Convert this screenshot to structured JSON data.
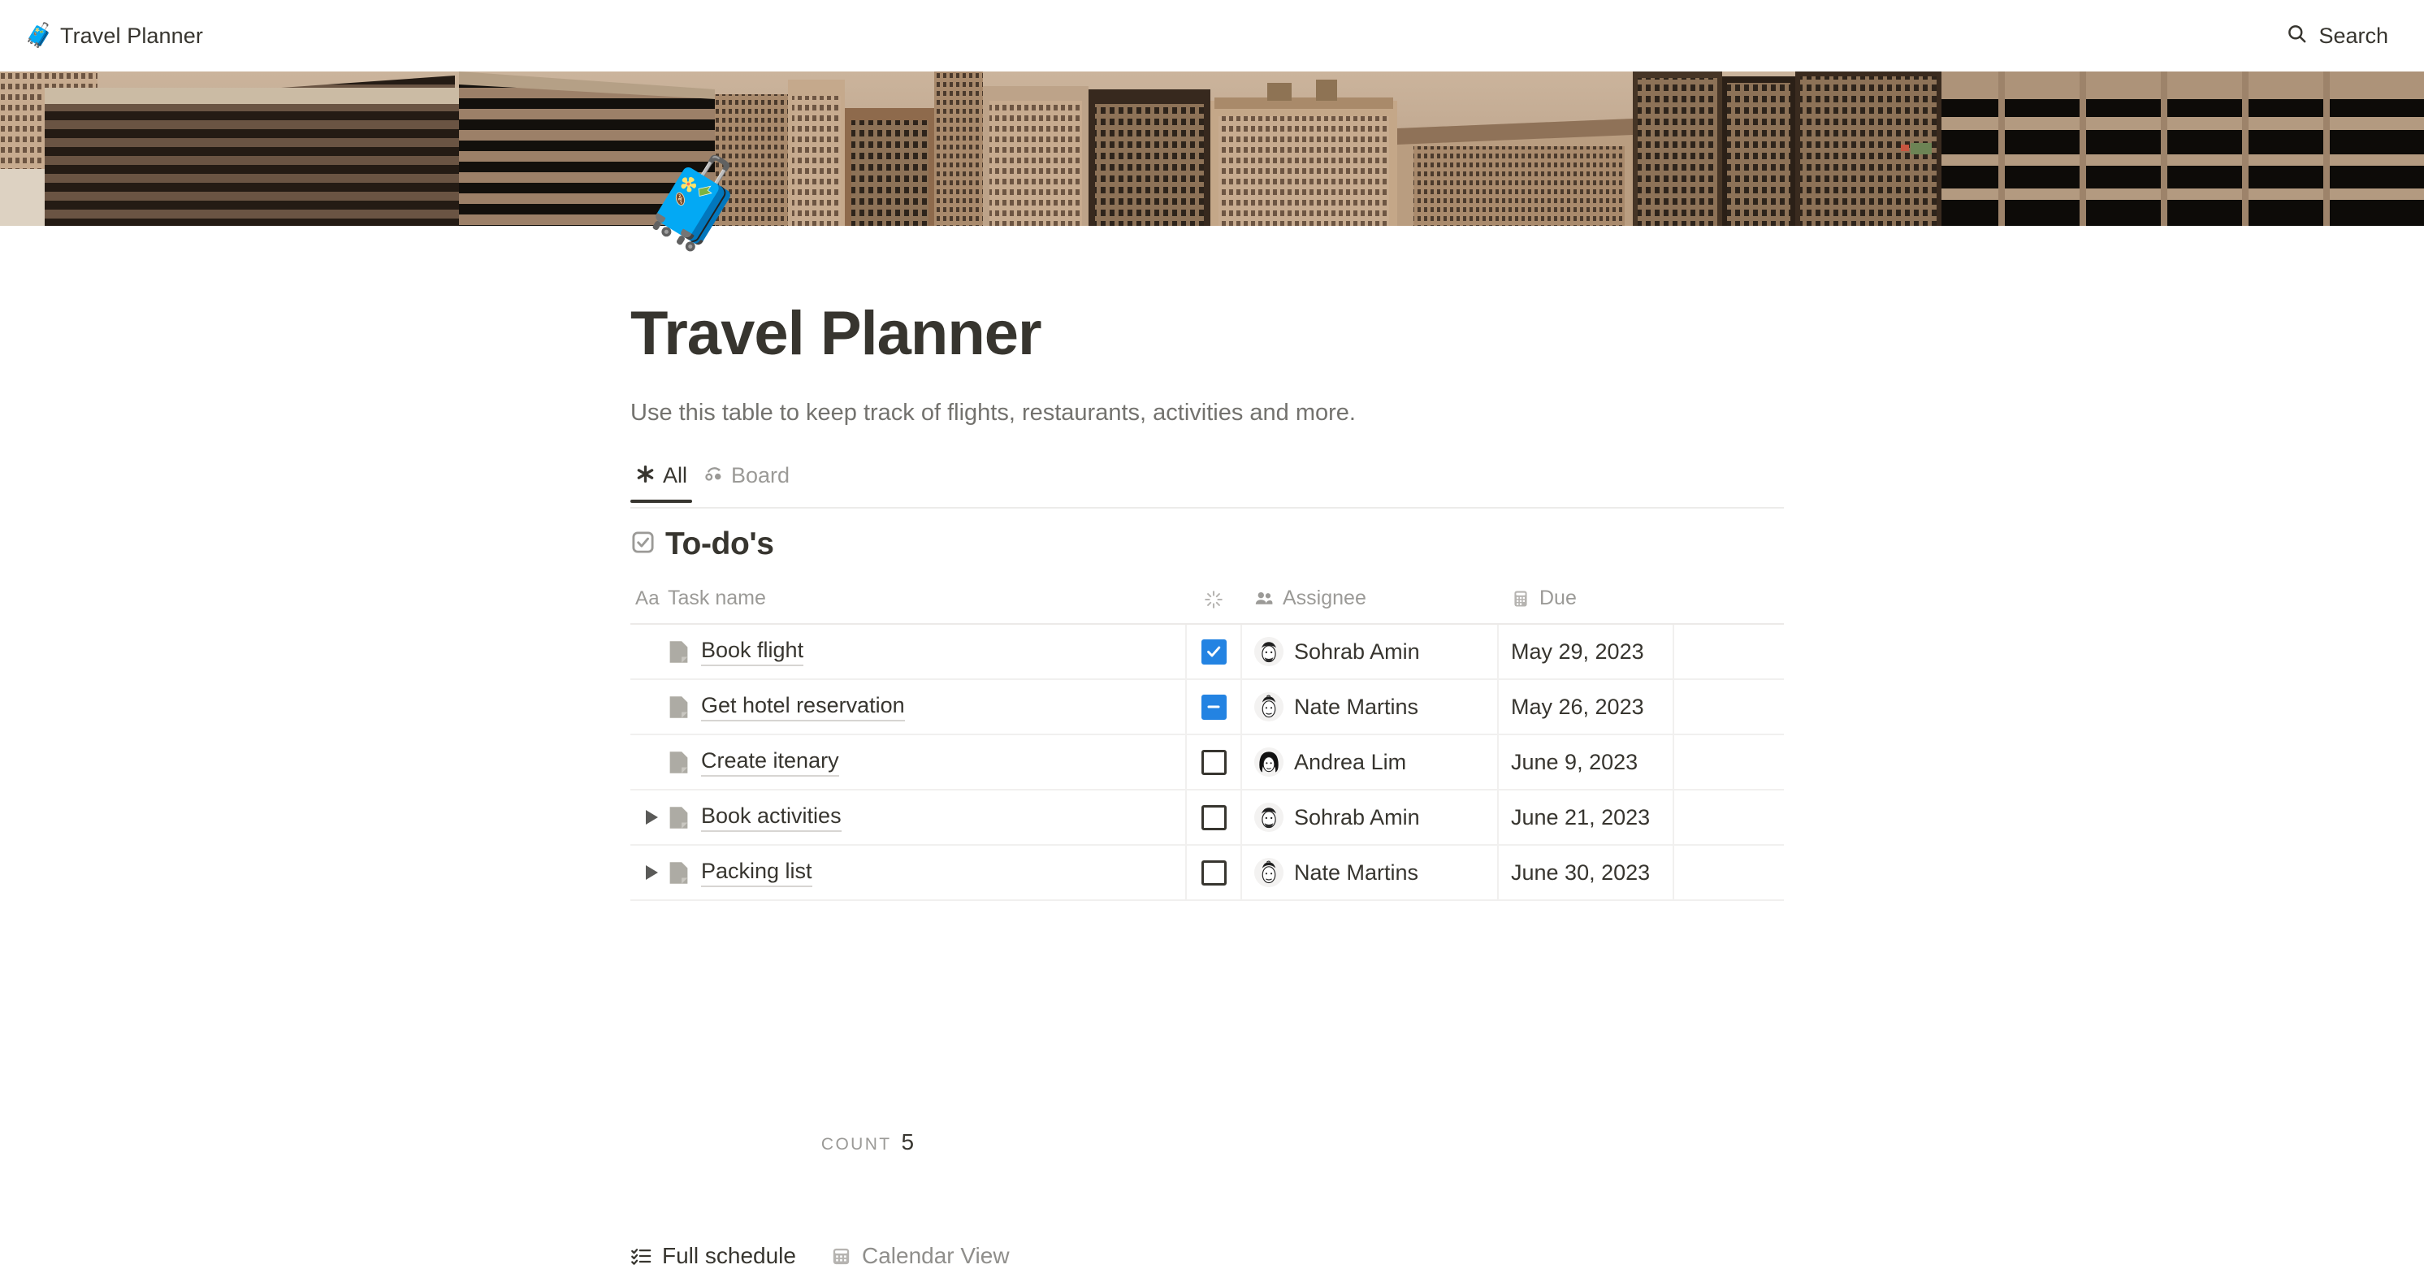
{
  "topbar": {
    "breadcrumb_emoji": "🧳",
    "breadcrumb_icon_name": "suitcase-icon",
    "breadcrumb_title": "Travel Planner",
    "search_icon_name": "search-icon",
    "search_label": "Search"
  },
  "cover": {
    "icon_name": "cover-image",
    "description": "Sepia aerial cityscape photo of skyscrapers"
  },
  "page": {
    "emoji": "🧳",
    "title": "Travel Planner",
    "description": "Use this table to keep track of flights, restaurants, activities and more."
  },
  "tabs": [
    {
      "label": "All",
      "icon": "✳️",
      "icon_name": "asterisk-icon",
      "active": true
    },
    {
      "label": "Board",
      "icon": "🎲",
      "icon_name": "board-icon",
      "active": false
    }
  ],
  "todo_section": {
    "icon": "☑️",
    "icon_name": "checkbox-icon",
    "title": "To-do's"
  },
  "table": {
    "columns": [
      {
        "label": "Task name",
        "icon_name": "text-type-icon",
        "type": "title"
      },
      {
        "label": "",
        "icon_name": "checkbox-type-icon",
        "type": "checkbox"
      },
      {
        "label": "Assignee",
        "icon_name": "person-type-icon",
        "type": "person"
      },
      {
        "label": "Due",
        "icon_name": "calendar-type-icon",
        "type": "date"
      },
      {
        "label": "",
        "icon_name": "blank-column",
        "type": "blank"
      }
    ],
    "rows": [
      {
        "expandable": false,
        "task": "Book flight",
        "checkbox": "checked",
        "assignee": "Sohrab Amin",
        "avatar_name": "avatar-sohrab-amin",
        "due": "May 29, 2023"
      },
      {
        "expandable": false,
        "task": "Get hotel reservation",
        "checkbox": "indeterminate",
        "assignee": "Nate Martins",
        "avatar_name": "avatar-nate-martins",
        "due": "May 26, 2023"
      },
      {
        "expandable": false,
        "task": "Create itenary",
        "checkbox": "unchecked",
        "assignee": "Andrea Lim",
        "avatar_name": "avatar-andrea-lim",
        "due": "June 9, 2023"
      },
      {
        "expandable": true,
        "task": "Book activities",
        "checkbox": "unchecked",
        "assignee": "Sohrab Amin",
        "avatar_name": "avatar-sohrab-amin",
        "due": "June 21, 2023"
      },
      {
        "expandable": true,
        "task": "Packing list",
        "checkbox": "unchecked",
        "assignee": "Nate Martins",
        "avatar_name": "avatar-nate-martins",
        "due": "June 30, 2023"
      }
    ],
    "footer": {
      "count_label": "COUNT",
      "count_value": "5"
    }
  },
  "bottom_links": [
    {
      "label": "Full schedule",
      "icon": "📝",
      "icon_name": "checklist-icon",
      "muted": false
    },
    {
      "label": "Calendar View",
      "icon": "📅",
      "icon_name": "calendar-icon",
      "muted": true
    }
  ],
  "colors": {
    "accent_blue": "#2383e2",
    "text_primary": "#37352f",
    "text_muted": "#9b9a97",
    "border": "#f1f0ef"
  }
}
